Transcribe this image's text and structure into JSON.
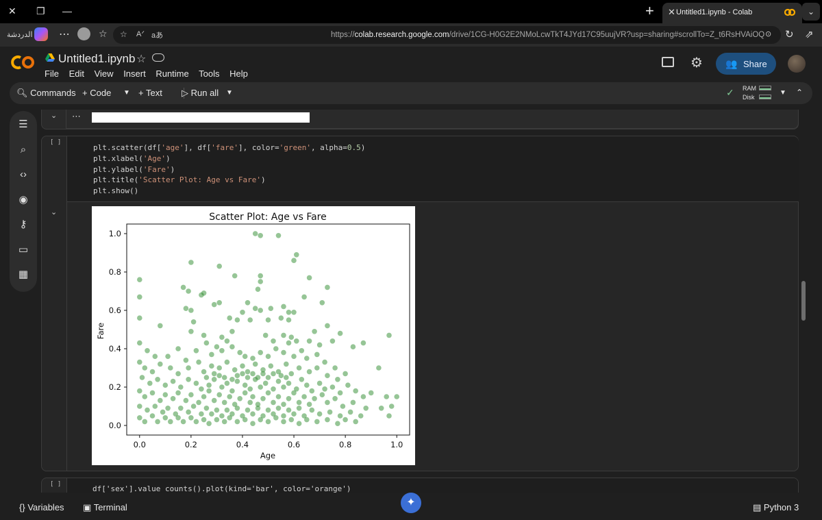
{
  "browser": {
    "tab_title": "Untitled1.ipynb - Colab",
    "chat_label": "الدردشة",
    "url_prefix": "https://",
    "url_domain": "colab.research.google.com",
    "url_rest": "/drive/1CG-H0G2E2NMoLcwTkT4JYd17C95uujVR?usp=sharing#scrollTo=Z_t6RsHVAiOQ"
  },
  "colab": {
    "notebook_title": "Untitled1.ipynb",
    "menu": [
      "File",
      "Edit",
      "View",
      "Insert",
      "Runtime",
      "Tools",
      "Help"
    ],
    "share_label": "Share"
  },
  "toolbar": {
    "commands": "Commands",
    "code": "Code",
    "text": "Text",
    "run_all": "Run all",
    "ram": "RAM",
    "disk": "Disk"
  },
  "cell": {
    "bracket": "[ ]",
    "code_lines": [
      "plt.scatter(df['age'], df['fare'], color='green', alpha=0.5)",
      "plt.xlabel('Age')",
      "plt.ylabel('Fare')",
      "plt.title('Scatter Plot: Age vs Fare')",
      "plt.show()"
    ]
  },
  "next_cell": {
    "bracket": "[ ]",
    "code": "df['sex'].value_counts().plot(kind='bar', color='orange')"
  },
  "bottom": {
    "variables": "Variables",
    "terminal": "Terminal",
    "runtime": "Python 3"
  },
  "chart_data": {
    "type": "scatter",
    "title": "Scatter Plot: Age vs Fare",
    "xlabel": "Age",
    "ylabel": "Fare",
    "xlim": [
      -0.05,
      1.05
    ],
    "ylim": [
      -0.05,
      1.05
    ],
    "xticks": [
      "0.0",
      "0.2",
      "0.4",
      "0.6",
      "0.8",
      "1.0"
    ],
    "yticks": [
      "0.0",
      "0.2",
      "0.4",
      "0.6",
      "0.8",
      "1.0"
    ],
    "color": "#2e8b2e",
    "alpha": 0.5,
    "grid": false,
    "points": [
      [
        0.45,
        1.0
      ],
      [
        0.47,
        0.99
      ],
      [
        0.54,
        0.99
      ],
      [
        0.61,
        0.89
      ],
      [
        0.6,
        0.86
      ],
      [
        0.2,
        0.85
      ],
      [
        0.31,
        0.83
      ],
      [
        0.0,
        0.76
      ],
      [
        0.37,
        0.78
      ],
      [
        0.47,
        0.78
      ],
      [
        0.47,
        0.75
      ],
      [
        0.66,
        0.77
      ],
      [
        0.17,
        0.72
      ],
      [
        0.19,
        0.7
      ],
      [
        0.73,
        0.72
      ],
      [
        0.46,
        0.71
      ],
      [
        0.0,
        0.67
      ],
      [
        0.24,
        0.68
      ],
      [
        0.25,
        0.69
      ],
      [
        0.29,
        0.63
      ],
      [
        0.31,
        0.64
      ],
      [
        0.64,
        0.67
      ],
      [
        0.71,
        0.64
      ],
      [
        0.42,
        0.64
      ],
      [
        0.45,
        0.61
      ],
      [
        0.51,
        0.61
      ],
      [
        0.56,
        0.62
      ],
      [
        0.0,
        0.56
      ],
      [
        0.18,
        0.61
      ],
      [
        0.2,
        0.6
      ],
      [
        0.4,
        0.59
      ],
      [
        0.47,
        0.6
      ],
      [
        0.58,
        0.59
      ],
      [
        0.6,
        0.59
      ],
      [
        0.08,
        0.52
      ],
      [
        0.21,
        0.54
      ],
      [
        0.35,
        0.56
      ],
      [
        0.38,
        0.55
      ],
      [
        0.43,
        0.55
      ],
      [
        0.5,
        0.55
      ],
      [
        0.55,
        0.56
      ],
      [
        0.58,
        0.55
      ],
      [
        0.68,
        0.49
      ],
      [
        0.73,
        0.52
      ],
      [
        0.36,
        0.49
      ],
      [
        0.32,
        0.46
      ],
      [
        0.56,
        0.47
      ],
      [
        0.59,
        0.46
      ],
      [
        0.25,
        0.47
      ],
      [
        0.49,
        0.47
      ],
      [
        0.2,
        0.49
      ],
      [
        0.52,
        0.44
      ],
      [
        0.61,
        0.44
      ],
      [
        0.34,
        0.44
      ],
      [
        0.58,
        0.43
      ],
      [
        0.66,
        0.44
      ],
      [
        0.7,
        0.42
      ],
      [
        0.75,
        0.44
      ],
      [
        0.78,
        0.48
      ],
      [
        0.87,
        0.43
      ],
      [
        0.97,
        0.47
      ],
      [
        0.83,
        0.41
      ],
      [
        0.0,
        0.43
      ],
      [
        0.03,
        0.39
      ],
      [
        0.06,
        0.36
      ],
      [
        0.11,
        0.36
      ],
      [
        0.15,
        0.4
      ],
      [
        0.18,
        0.34
      ],
      [
        0.22,
        0.39
      ],
      [
        0.26,
        0.43
      ],
      [
        0.28,
        0.37
      ],
      [
        0.3,
        0.41
      ],
      [
        0.32,
        0.39
      ],
      [
        0.36,
        0.41
      ],
      [
        0.39,
        0.38
      ],
      [
        0.41,
        0.36
      ],
      [
        0.44,
        0.35
      ],
      [
        0.47,
        0.38
      ],
      [
        0.5,
        0.36
      ],
      [
        0.53,
        0.4
      ],
      [
        0.56,
        0.38
      ],
      [
        0.6,
        0.36
      ],
      [
        0.63,
        0.39
      ],
      [
        0.65,
        0.35
      ],
      [
        0.69,
        0.37
      ],
      [
        0.72,
        0.33
      ],
      [
        0.76,
        0.3
      ],
      [
        0.8,
        0.27
      ],
      [
        0.93,
        0.3
      ],
      [
        0.0,
        0.33
      ],
      [
        0.02,
        0.3
      ],
      [
        0.05,
        0.28
      ],
      [
        0.08,
        0.32
      ],
      [
        0.12,
        0.3
      ],
      [
        0.15,
        0.27
      ],
      [
        0.19,
        0.3
      ],
      [
        0.23,
        0.33
      ],
      [
        0.25,
        0.28
      ],
      [
        0.28,
        0.31
      ],
      [
        0.31,
        0.3
      ],
      [
        0.34,
        0.33
      ],
      [
        0.37,
        0.29
      ],
      [
        0.4,
        0.31
      ],
      [
        0.42,
        0.28
      ],
      [
        0.45,
        0.32
      ],
      [
        0.48,
        0.29
      ],
      [
        0.51,
        0.31
      ],
      [
        0.54,
        0.28
      ],
      [
        0.57,
        0.32
      ],
      [
        0.59,
        0.27
      ],
      [
        0.62,
        0.3
      ],
      [
        0.66,
        0.28
      ],
      [
        0.69,
        0.3
      ],
      [
        0.73,
        0.26
      ],
      [
        0.77,
        0.24
      ],
      [
        0.01,
        0.25
      ],
      [
        0.04,
        0.22
      ],
      [
        0.07,
        0.24
      ],
      [
        0.1,
        0.21
      ],
      [
        0.13,
        0.23
      ],
      [
        0.16,
        0.2
      ],
      [
        0.19,
        0.24
      ],
      [
        0.22,
        0.22
      ],
      [
        0.24,
        0.19
      ],
      [
        0.27,
        0.21
      ],
      [
        0.29,
        0.24
      ],
      [
        0.32,
        0.2
      ],
      [
        0.34,
        0.22
      ],
      [
        0.36,
        0.18
      ],
      [
        0.38,
        0.23
      ],
      [
        0.41,
        0.21
      ],
      [
        0.43,
        0.19
      ],
      [
        0.45,
        0.24
      ],
      [
        0.47,
        0.2
      ],
      [
        0.49,
        0.22
      ],
      [
        0.52,
        0.19
      ],
      [
        0.54,
        0.23
      ],
      [
        0.56,
        0.2
      ],
      [
        0.58,
        0.22
      ],
      [
        0.61,
        0.19
      ],
      [
        0.63,
        0.24
      ],
      [
        0.65,
        0.21
      ],
      [
        0.67,
        0.18
      ],
      [
        0.7,
        0.22
      ],
      [
        0.72,
        0.19
      ],
      [
        0.75,
        0.2
      ],
      [
        0.78,
        0.17
      ],
      [
        0.81,
        0.21
      ],
      [
        0.84,
        0.18
      ],
      [
        0.87,
        0.15
      ],
      [
        0.9,
        0.17
      ],
      [
        0.96,
        0.15
      ],
      [
        1.0,
        0.15
      ],
      [
        0.0,
        0.18
      ],
      [
        0.02,
        0.15
      ],
      [
        0.05,
        0.17
      ],
      [
        0.08,
        0.13
      ],
      [
        0.1,
        0.16
      ],
      [
        0.13,
        0.14
      ],
      [
        0.15,
        0.17
      ],
      [
        0.18,
        0.13
      ],
      [
        0.2,
        0.16
      ],
      [
        0.23,
        0.12
      ],
      [
        0.25,
        0.15
      ],
      [
        0.27,
        0.18
      ],
      [
        0.29,
        0.13
      ],
      [
        0.31,
        0.16
      ],
      [
        0.33,
        0.12
      ],
      [
        0.35,
        0.15
      ],
      [
        0.37,
        0.11
      ],
      [
        0.39,
        0.14
      ],
      [
        0.41,
        0.17
      ],
      [
        0.43,
        0.12
      ],
      [
        0.44,
        0.15
      ],
      [
        0.46,
        0.11
      ],
      [
        0.48,
        0.14
      ],
      [
        0.5,
        0.17
      ],
      [
        0.52,
        0.12
      ],
      [
        0.54,
        0.15
      ],
      [
        0.56,
        0.11
      ],
      [
        0.58,
        0.14
      ],
      [
        0.6,
        0.17
      ],
      [
        0.62,
        0.12
      ],
      [
        0.64,
        0.15
      ],
      [
        0.66,
        0.11
      ],
      [
        0.68,
        0.14
      ],
      [
        0.71,
        0.16
      ],
      [
        0.73,
        0.12
      ],
      [
        0.76,
        0.14
      ],
      [
        0.79,
        0.1
      ],
      [
        0.83,
        0.12
      ],
      [
        0.88,
        0.09
      ],
      [
        0.94,
        0.09
      ],
      [
        0.98,
        0.1
      ],
      [
        0.0,
        0.1
      ],
      [
        0.03,
        0.08
      ],
      [
        0.06,
        0.1
      ],
      [
        0.09,
        0.07
      ],
      [
        0.11,
        0.09
      ],
      [
        0.14,
        0.06
      ],
      [
        0.16,
        0.09
      ],
      [
        0.19,
        0.07
      ],
      [
        0.21,
        0.1
      ],
      [
        0.24,
        0.06
      ],
      [
        0.26,
        0.09
      ],
      [
        0.28,
        0.06
      ],
      [
        0.3,
        0.08
      ],
      [
        0.32,
        0.05
      ],
      [
        0.34,
        0.08
      ],
      [
        0.36,
        0.06
      ],
      [
        0.38,
        0.09
      ],
      [
        0.4,
        0.05
      ],
      [
        0.42,
        0.08
      ],
      [
        0.44,
        0.06
      ],
      [
        0.46,
        0.09
      ],
      [
        0.48,
        0.05
      ],
      [
        0.5,
        0.08
      ],
      [
        0.52,
        0.06
      ],
      [
        0.54,
        0.09
      ],
      [
        0.56,
        0.05
      ],
      [
        0.58,
        0.08
      ],
      [
        0.6,
        0.06
      ],
      [
        0.62,
        0.09
      ],
      [
        0.64,
        0.05
      ],
      [
        0.67,
        0.08
      ],
      [
        0.7,
        0.06
      ],
      [
        0.74,
        0.07
      ],
      [
        0.78,
        0.05
      ],
      [
        0.82,
        0.07
      ],
      [
        0.86,
        0.05
      ],
      [
        0.97,
        0.05
      ],
      [
        0.0,
        0.04
      ],
      [
        0.02,
        0.02
      ],
      [
        0.05,
        0.05
      ],
      [
        0.07,
        0.02
      ],
      [
        0.1,
        0.04
      ],
      [
        0.12,
        0.02
      ],
      [
        0.15,
        0.04
      ],
      [
        0.17,
        0.02
      ],
      [
        0.2,
        0.04
      ],
      [
        0.22,
        0.02
      ],
      [
        0.25,
        0.03
      ],
      [
        0.27,
        0.01
      ],
      [
        0.3,
        0.03
      ],
      [
        0.33,
        0.02
      ],
      [
        0.35,
        0.04
      ],
      [
        0.38,
        0.02
      ],
      [
        0.41,
        0.03
      ],
      [
        0.44,
        0.01
      ],
      [
        0.47,
        0.03
      ],
      [
        0.5,
        0.02
      ],
      [
        0.53,
        0.04
      ],
      [
        0.56,
        0.02
      ],
      [
        0.59,
        0.03
      ],
      [
        0.62,
        0.01
      ],
      [
        0.65,
        0.03
      ],
      [
        0.69,
        0.02
      ],
      [
        0.73,
        0.03
      ],
      [
        0.77,
        0.01
      ],
      [
        0.8,
        0.03
      ],
      [
        0.84,
        0.02
      ],
      [
        0.4,
        0.27
      ],
      [
        0.42,
        0.25
      ],
      [
        0.44,
        0.27
      ],
      [
        0.46,
        0.25
      ],
      [
        0.48,
        0.27
      ],
      [
        0.5,
        0.25
      ],
      [
        0.52,
        0.27
      ],
      [
        0.38,
        0.26
      ],
      [
        0.36,
        0.24
      ],
      [
        0.55,
        0.26
      ],
      [
        0.57,
        0.25
      ],
      [
        0.33,
        0.25
      ],
      [
        0.31,
        0.26
      ],
      [
        0.29,
        0.27
      ],
      [
        0.26,
        0.25
      ]
    ]
  }
}
